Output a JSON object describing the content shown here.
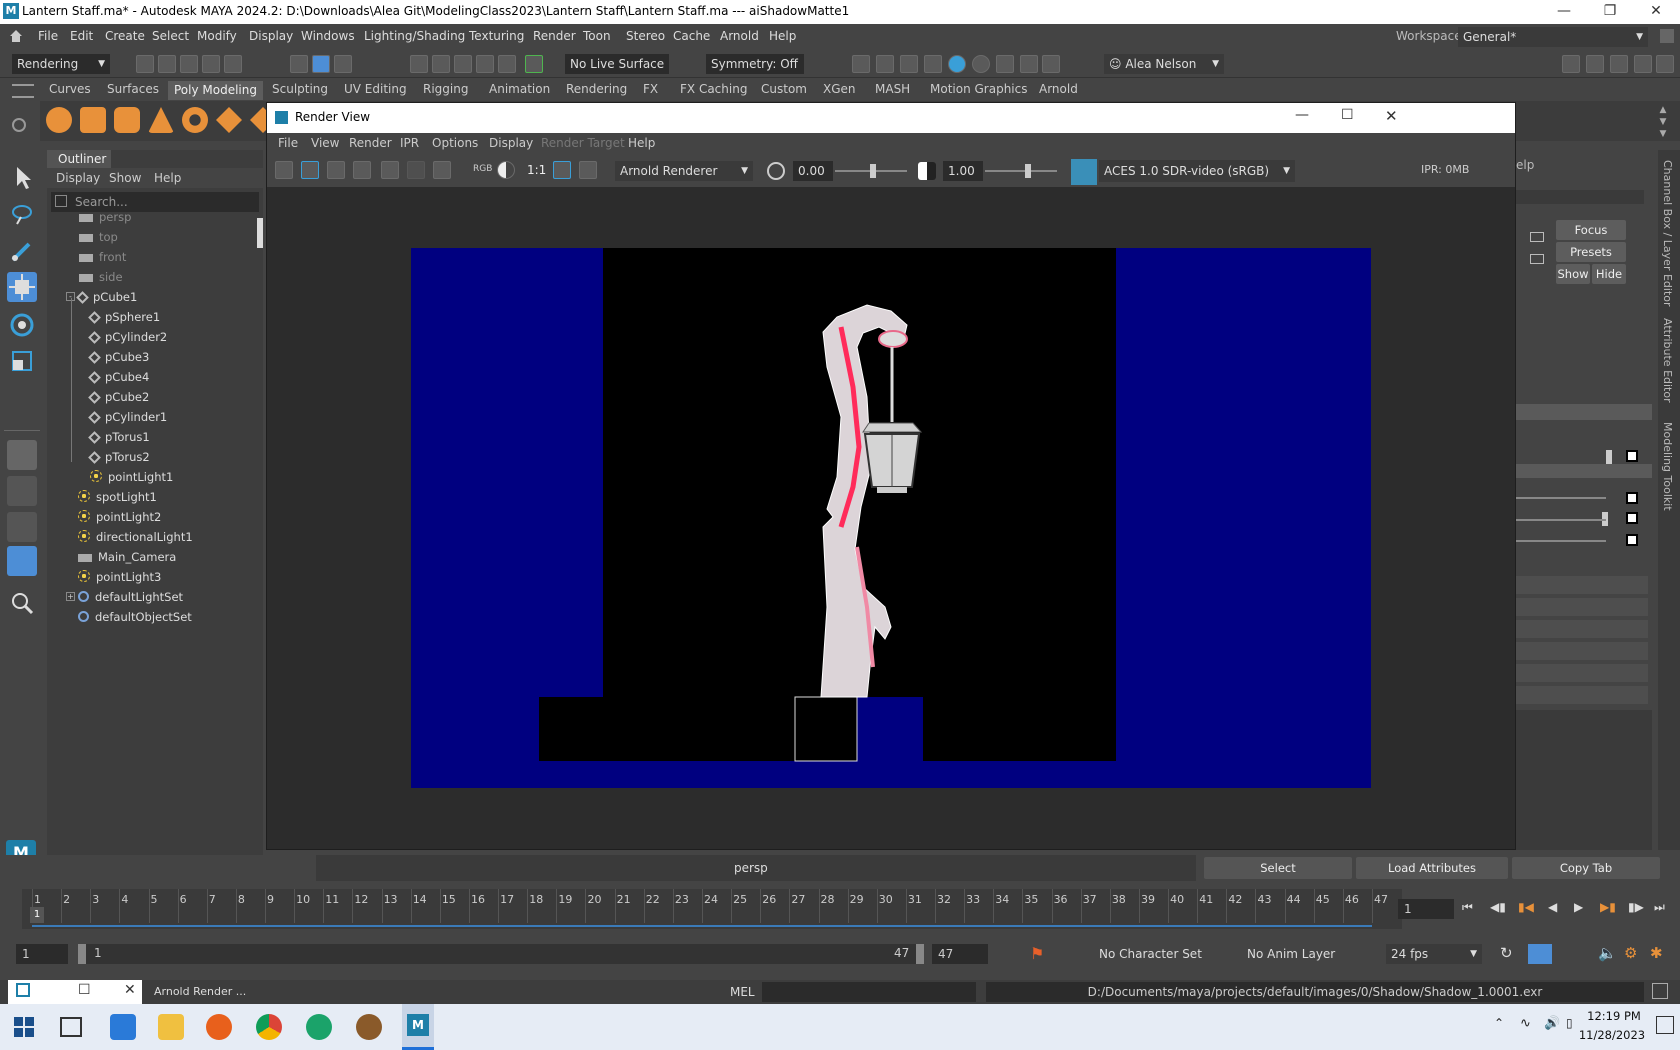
{
  "app": {
    "title": "Lantern Staff.ma* - Autodesk MAYA 2024.2: D:\\Downloads\\Alea Git\\ModelingClass2023\\Lantern Staff\\Lantern Staff.ma   ---   aiShadowMatte1",
    "logo_letter": "M",
    "workspace_label": "Workspace:",
    "workspace_value": "General*"
  },
  "main_menu": [
    "File",
    "Edit",
    "Create",
    "Select",
    "Modify",
    "Display",
    "Windows",
    "Lighting/Shading",
    "Texturing",
    "Render",
    "Toon",
    "Stereo",
    "Cache",
    "Arnold",
    "Help"
  ],
  "status_line": {
    "menuset": "Rendering",
    "live_surface": "No Live Surface",
    "symmetry": "Symmetry: Off",
    "user": "Alea Nelson"
  },
  "shelf_tabs": [
    "Curves",
    "Surfaces",
    "Poly Modeling",
    "Sculpting",
    "UV Editing",
    "Rigging",
    "Animation",
    "Rendering",
    "FX",
    "FX Caching",
    "Custom",
    "XGen",
    "MASH",
    "Motion Graphics",
    "Arnold"
  ],
  "shelf_active": "Poly Modeling",
  "outliner": {
    "title": "Outliner",
    "menu": [
      "Display",
      "Show",
      "Help"
    ],
    "search_placeholder": "Search...",
    "items": [
      {
        "label": "persp",
        "indent": 1,
        "icon": "camera",
        "dim": true
      },
      {
        "label": "top",
        "indent": 1,
        "icon": "camera",
        "dim": true
      },
      {
        "label": "front",
        "indent": 1,
        "icon": "camera",
        "dim": true
      },
      {
        "label": "side",
        "indent": 1,
        "icon": "camera",
        "dim": true
      },
      {
        "label": "pCube1",
        "indent": 0,
        "icon": "mesh",
        "expander": "-"
      },
      {
        "label": "pSphere1",
        "indent": 2,
        "icon": "mesh"
      },
      {
        "label": "pCylinder2",
        "indent": 2,
        "icon": "mesh"
      },
      {
        "label": "pCube3",
        "indent": 2,
        "icon": "mesh"
      },
      {
        "label": "pCube4",
        "indent": 2,
        "icon": "mesh"
      },
      {
        "label": "pCube2",
        "indent": 2,
        "icon": "mesh"
      },
      {
        "label": "pCylinder1",
        "indent": 2,
        "icon": "mesh"
      },
      {
        "label": "pTorus1",
        "indent": 2,
        "icon": "mesh"
      },
      {
        "label": "pTorus2",
        "indent": 2,
        "icon": "mesh"
      },
      {
        "label": "pointLight1",
        "indent": 2,
        "icon": "light"
      },
      {
        "label": "spotLight1",
        "indent": 0,
        "icon": "light"
      },
      {
        "label": "pointLight2",
        "indent": 0,
        "icon": "light"
      },
      {
        "label": "directionalLight1",
        "indent": 0,
        "icon": "light"
      },
      {
        "label": "Main_Camera",
        "indent": 0,
        "icon": "camera"
      },
      {
        "label": "pointLight3",
        "indent": 0,
        "icon": "light"
      },
      {
        "label": "defaultLightSet",
        "indent": 0,
        "icon": "set",
        "expander": "+"
      },
      {
        "label": "defaultObjectSet",
        "indent": 0,
        "icon": "set"
      }
    ]
  },
  "render_view": {
    "title": "Render View",
    "menu": [
      "File",
      "View",
      "Render",
      "IPR",
      "Options",
      "Display",
      "Render Target",
      "Help"
    ],
    "disabled_menu": "Render Target",
    "renderer": "Arnold Renderer",
    "exposure": "0.00",
    "gamma": "1.00",
    "view_transform": "ACES 1.0 SDR-video (sRGB)",
    "ratio_label": "1:1",
    "rgb_label": "RGB",
    "ipr_memory": "IPR: 0MB"
  },
  "right_panel": {
    "buttons": [
      "Focus",
      "Presets",
      "Show",
      "Hide"
    ],
    "vertical_tabs": [
      "Channel Box / Layer Editor",
      "Attribute Editor",
      "Modeling Toolkit"
    ],
    "help_fragment": "elp"
  },
  "bottom_bar": {
    "viewport_label": "persp",
    "select": "Select",
    "load_attributes": "Load Attributes",
    "copy_tab": "Copy Tab"
  },
  "timeline": {
    "ticks": [
      "1",
      "2",
      "3",
      "4",
      "5",
      "6",
      "7",
      "8",
      "9",
      "10",
      "11",
      "12",
      "13",
      "14",
      "15",
      "16",
      "17",
      "18",
      "19",
      "20",
      "21",
      "22",
      "23",
      "24",
      "25",
      "26",
      "27",
      "28",
      "29",
      "30",
      "31",
      "32",
      "33",
      "34",
      "35",
      "36",
      "37",
      "38",
      "39",
      "40",
      "41",
      "42",
      "43",
      "44",
      "45",
      "46",
      "47"
    ],
    "current_frame_marker": "1",
    "current_frame": "1"
  },
  "range": {
    "start": "1",
    "inner_start": "1",
    "inner_end": "47",
    "end": "47",
    "character_set": "No Character Set",
    "anim_layer": "No Anim Layer",
    "fps": "24 fps"
  },
  "mel": {
    "label": "MEL",
    "message": "D:/Documents/maya/projects/default/images/0/Shadow/Shadow_1.0001.exr",
    "minimized_window": "Arnold Render ..."
  },
  "taskbar": {
    "time": "12:19 PM",
    "date": "11/28/2023"
  },
  "colors": {
    "background_blue": "#000080",
    "matte_black": "#000000",
    "pole_pink": "#e8305a",
    "maya_blue": "#1e7fa8"
  }
}
